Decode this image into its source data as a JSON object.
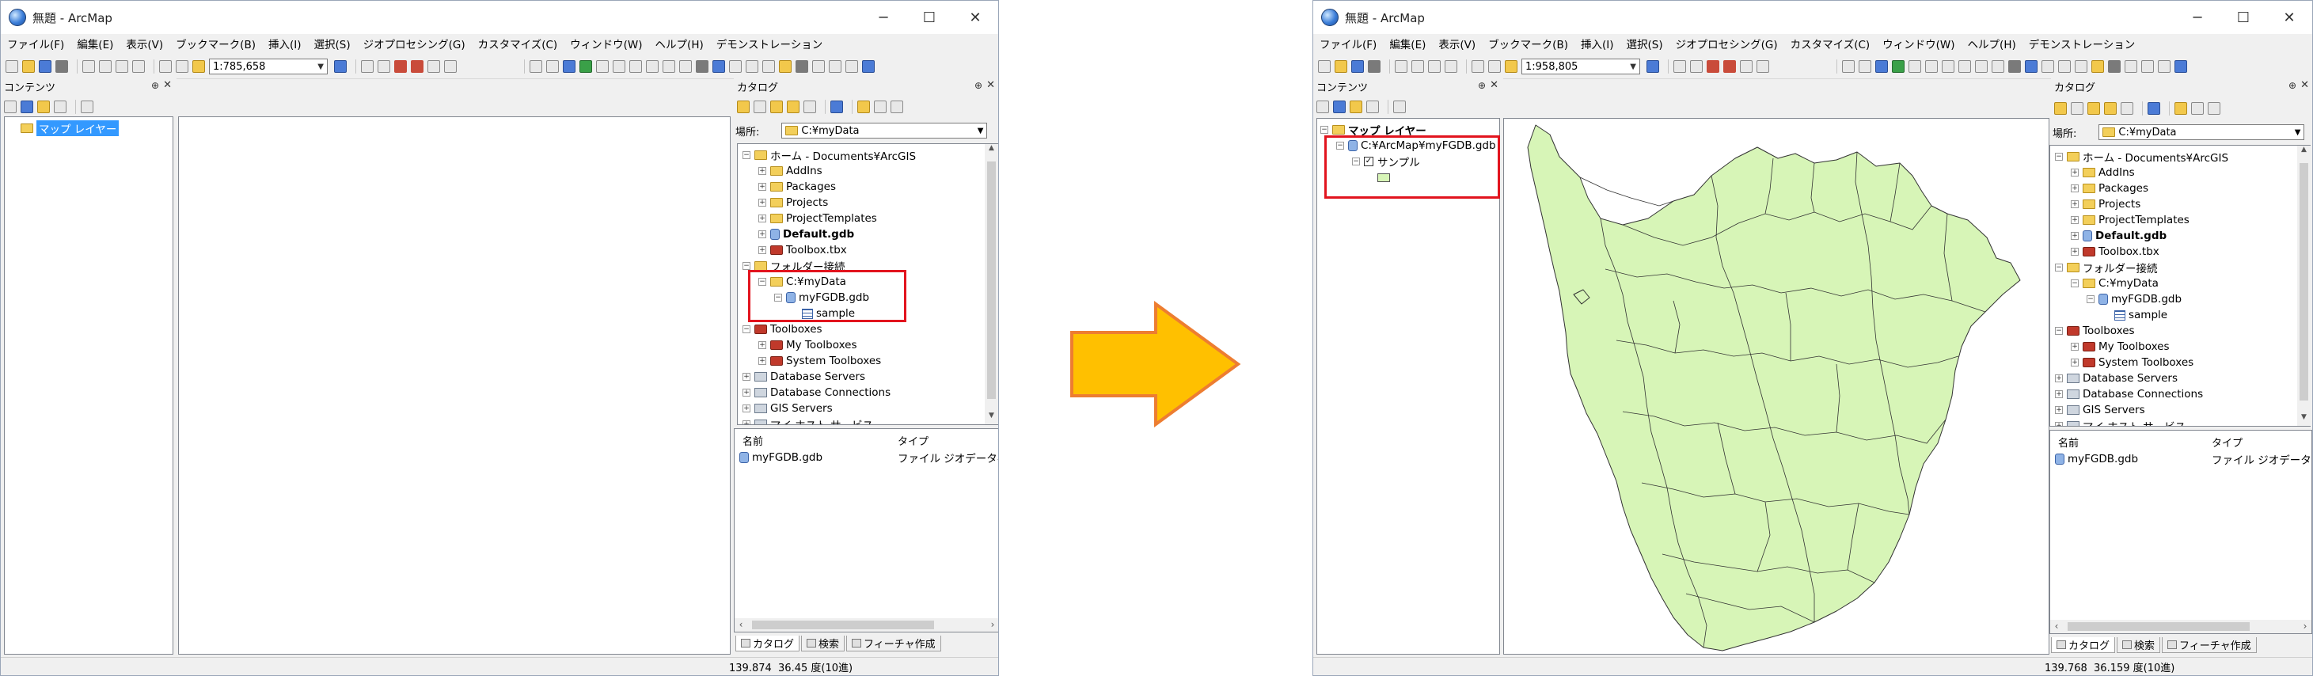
{
  "colors": {
    "accent_red": "#e2141e",
    "arrow_fill": "#ffc000",
    "arrow_stroke": "#ed7d31",
    "map_fill": "#d7f5b7",
    "selection": "#3399ff"
  },
  "left": {
    "title": "無題 - ArcMap",
    "controls": [
      "─",
      "☐",
      "✕"
    ],
    "menu": [
      "ファイル(F)",
      "編集(E)",
      "表示(V)",
      "ブックマーク(B)",
      "挿入(I)",
      "選択(S)",
      "ジオプロセシング(G)",
      "カスタマイズ(C)",
      "ウィンドウ(W)",
      "ヘルプ(H)",
      "デモンストレーション"
    ],
    "scale": "1:785,658",
    "toc": {
      "header": "コンテンツ",
      "layer_label": "マップ レイヤー"
    },
    "catalog": {
      "header": "カタログ",
      "location_label": "場所:",
      "location_value": "C:¥myData",
      "tree": [
        {
          "label": "ホーム - Documents¥ArcGIS",
          "icon": "folder-icon",
          "level": 0,
          "exp": "⊟",
          "bold": false
        },
        {
          "label": "AddIns",
          "icon": "folder-icon",
          "level": 1,
          "exp": "⊞",
          "bold": false
        },
        {
          "label": "Packages",
          "icon": "folder-icon",
          "level": 1,
          "exp": "⊞",
          "bold": false
        },
        {
          "label": "Projects",
          "icon": "folder-icon",
          "level": 1,
          "exp": "⊞",
          "bold": false
        },
        {
          "label": "ProjectTemplates",
          "icon": "folder-icon",
          "level": 1,
          "exp": "⊞",
          "bold": false
        },
        {
          "label": "Default.gdb",
          "icon": "geodatabase-icon",
          "level": 1,
          "exp": "⊞",
          "bold": true
        },
        {
          "label": "Toolbox.tbx",
          "icon": "toolbox-icon",
          "level": 1,
          "exp": "⊞",
          "bold": false
        },
        {
          "label": "フォルダー接続",
          "icon": "folder-icon",
          "level": 0,
          "exp": "⊟",
          "bold": false
        },
        {
          "label": "C:¥myData",
          "icon": "folder-icon",
          "level": 1,
          "exp": "⊟",
          "bold": false
        },
        {
          "label": "myFGDB.gdb",
          "icon": "geodatabase-icon",
          "level": 2,
          "exp": "⊟",
          "bold": false
        },
        {
          "label": "sample",
          "icon": "feature-class-icon",
          "level": 3,
          "exp": "",
          "bold": false
        },
        {
          "label": "Toolboxes",
          "icon": "toolbox-icon",
          "level": 0,
          "exp": "⊟",
          "bold": false
        },
        {
          "label": "My Toolboxes",
          "icon": "toolbox-icon",
          "level": 1,
          "exp": "⊞",
          "bold": false
        },
        {
          "label": "System Toolboxes",
          "icon": "toolbox-icon",
          "level": 1,
          "exp": "⊞",
          "bold": false
        },
        {
          "label": "Database Servers",
          "icon": "server-icon",
          "level": 0,
          "exp": "⊞",
          "bold": false
        },
        {
          "label": "Database Connections",
          "icon": "server-icon",
          "level": 0,
          "exp": "⊞",
          "bold": false
        },
        {
          "label": "GIS Servers",
          "icon": "server-icon",
          "level": 0,
          "exp": "⊞",
          "bold": false
        },
        {
          "label": "マイ ホスト サービス",
          "icon": "server-icon",
          "level": 0,
          "exp": "⊞",
          "bold": false
        }
      ],
      "columns": [
        "名前",
        "タイプ"
      ],
      "content_row": {
        "name": "myFGDB.gdb",
        "type": "ファイル ジオデータベー"
      },
      "tabs": [
        "カタログ",
        "検索",
        "フィーチャ作成"
      ]
    },
    "status": "139.874  36.45 度(10進)"
  },
  "right": {
    "title": "無題 - ArcMap",
    "controls": [
      "─",
      "☐",
      "✕"
    ],
    "menu": [
      "ファイル(F)",
      "編集(E)",
      "表示(V)",
      "ブックマーク(B)",
      "挿入(I)",
      "選択(S)",
      "ジオプロセシング(G)",
      "カスタマイズ(C)",
      "ウィンドウ(W)",
      "ヘルプ(H)",
      "デモンストレーション"
    ],
    "scale": "1:958,805",
    "toc": {
      "header": "コンテンツ",
      "layer_label": "マップ レイヤー",
      "workspace": "C:¥ArcMap¥myFGDB.gdb",
      "layer": "サンプル",
      "checked": "☑"
    },
    "catalog": {
      "header": "カタログ",
      "location_label": "場所:",
      "location_value": "C:¥myData",
      "tree": [
        {
          "label": "ホーム - Documents¥ArcGIS",
          "icon": "folder-icon",
          "level": 0,
          "exp": "⊟",
          "bold": false
        },
        {
          "label": "AddIns",
          "icon": "folder-icon",
          "level": 1,
          "exp": "⊞",
          "bold": false
        },
        {
          "label": "Packages",
          "icon": "folder-icon",
          "level": 1,
          "exp": "⊞",
          "bold": false
        },
        {
          "label": "Projects",
          "icon": "folder-icon",
          "level": 1,
          "exp": "⊞",
          "bold": false
        },
        {
          "label": "ProjectTemplates",
          "icon": "folder-icon",
          "level": 1,
          "exp": "⊞",
          "bold": false
        },
        {
          "label": "Default.gdb",
          "icon": "geodatabase-icon",
          "level": 1,
          "exp": "⊞",
          "bold": true
        },
        {
          "label": "Toolbox.tbx",
          "icon": "toolbox-icon",
          "level": 1,
          "exp": "⊞",
          "bold": false
        },
        {
          "label": "フォルダー接続",
          "icon": "folder-icon",
          "level": 0,
          "exp": "⊟",
          "bold": false
        },
        {
          "label": "C:¥myData",
          "icon": "folder-icon",
          "level": 1,
          "exp": "⊟",
          "bold": false
        },
        {
          "label": "myFGDB.gdb",
          "icon": "geodatabase-icon",
          "level": 2,
          "exp": "⊟",
          "bold": false
        },
        {
          "label": "sample",
          "icon": "feature-class-icon",
          "level": 3,
          "exp": "",
          "bold": false
        },
        {
          "label": "Toolboxes",
          "icon": "toolbox-icon",
          "level": 0,
          "exp": "⊟",
          "bold": false
        },
        {
          "label": "My Toolboxes",
          "icon": "toolbox-icon",
          "level": 1,
          "exp": "⊞",
          "bold": false
        },
        {
          "label": "System Toolboxes",
          "icon": "toolbox-icon",
          "level": 1,
          "exp": "⊞",
          "bold": false
        },
        {
          "label": "Database Servers",
          "icon": "server-icon",
          "level": 0,
          "exp": "⊞",
          "bold": false
        },
        {
          "label": "Database Connections",
          "icon": "server-icon",
          "level": 0,
          "exp": "⊞",
          "bold": false
        },
        {
          "label": "GIS Servers",
          "icon": "server-icon",
          "level": 0,
          "exp": "⊞",
          "bold": false
        },
        {
          "label": "マイ ホスト サービス",
          "icon": "server-icon",
          "level": 0,
          "exp": "⊞",
          "bold": false
        }
      ],
      "columns": [
        "名前",
        "タイプ"
      ],
      "content_row": {
        "name": "myFGDB.gdb",
        "type": "ファイル ジオデータベー"
      },
      "tabs": [
        "カタログ",
        "検索",
        "フィーチャ作成"
      ]
    },
    "status": "139.768  36.159 度(10進)"
  }
}
